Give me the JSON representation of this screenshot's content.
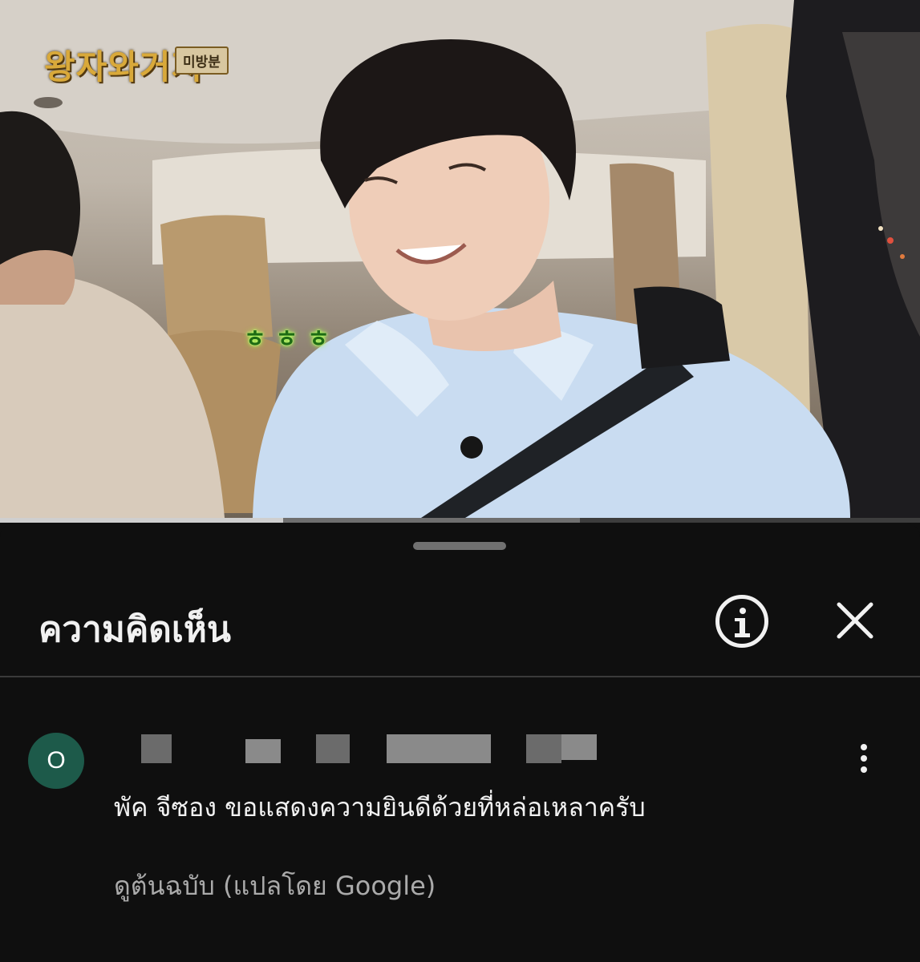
{
  "video": {
    "show_logo": "왕자와거지",
    "show_tag": "미방분",
    "caption": "ㅎㅎㅎ",
    "progress": {
      "played_fraction": 0.308,
      "buffered_fraction": 0.63
    }
  },
  "sheet": {
    "title": "ความคิดเห็น",
    "info_icon": "info-icon",
    "close_icon": "close-icon"
  },
  "comment": {
    "avatar_initial": "O",
    "author_redacted": true,
    "text": "พัค จีซอง ขอแสดงความยินดีด้วยที่หล่อเหลาครับ",
    "see_original": "ดูต้นฉบับ (แปลโดย Google)",
    "more_icon": "more-vert-icon"
  },
  "colors": {
    "background": "#0f0f0f",
    "text": "#f1f1f1",
    "secondary_text": "#aaaaaa",
    "avatar": "#1d5a4a",
    "divider": "#3a3a3a"
  }
}
